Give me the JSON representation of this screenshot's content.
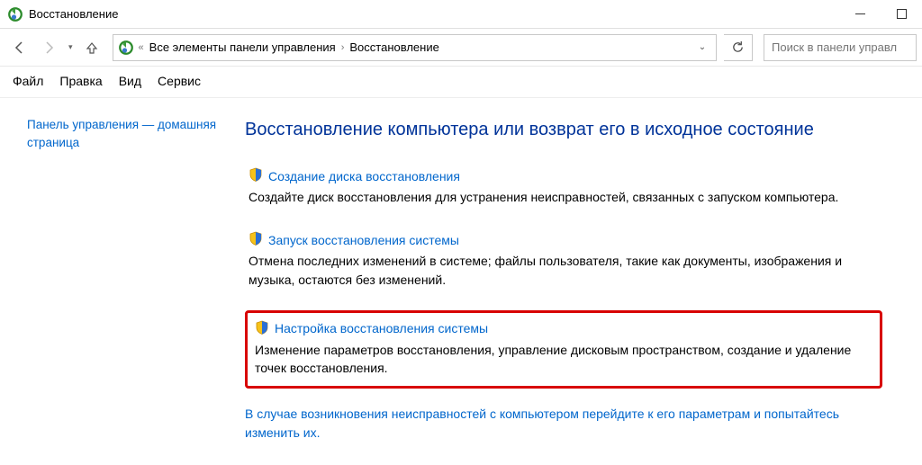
{
  "titlebar": {
    "title": "Восстановление"
  },
  "address": {
    "crumb1": "Все элементы панели управления",
    "crumb2": "Восстановление"
  },
  "search": {
    "placeholder": "Поиск в панели управл"
  },
  "menu": {
    "file": "Файл",
    "edit": "Правка",
    "view": "Вид",
    "tools": "Сервис"
  },
  "sidebar": {
    "home_link": "Панель управления — домашняя страница"
  },
  "main": {
    "title": "Восстановление компьютера или возврат его в исходное состояние",
    "items": [
      {
        "link": "Создание диска восстановления",
        "desc": "Создайте диск восстановления для устранения неисправностей, связанных с запуском компьютера."
      },
      {
        "link": "Запуск восстановления системы",
        "desc": "Отмена последних изменений в системе; файлы пользователя, такие как документы, изображения и музыка, остаются без изменений."
      },
      {
        "link": "Настройка восстановления системы",
        "desc": "Изменение параметров восстановления, управление дисковым пространством, создание и удаление точек восстановления."
      }
    ],
    "footer_link": "В случае возникновения неисправностей с компьютером перейдите к его параметрам и попытайтесь изменить их."
  }
}
